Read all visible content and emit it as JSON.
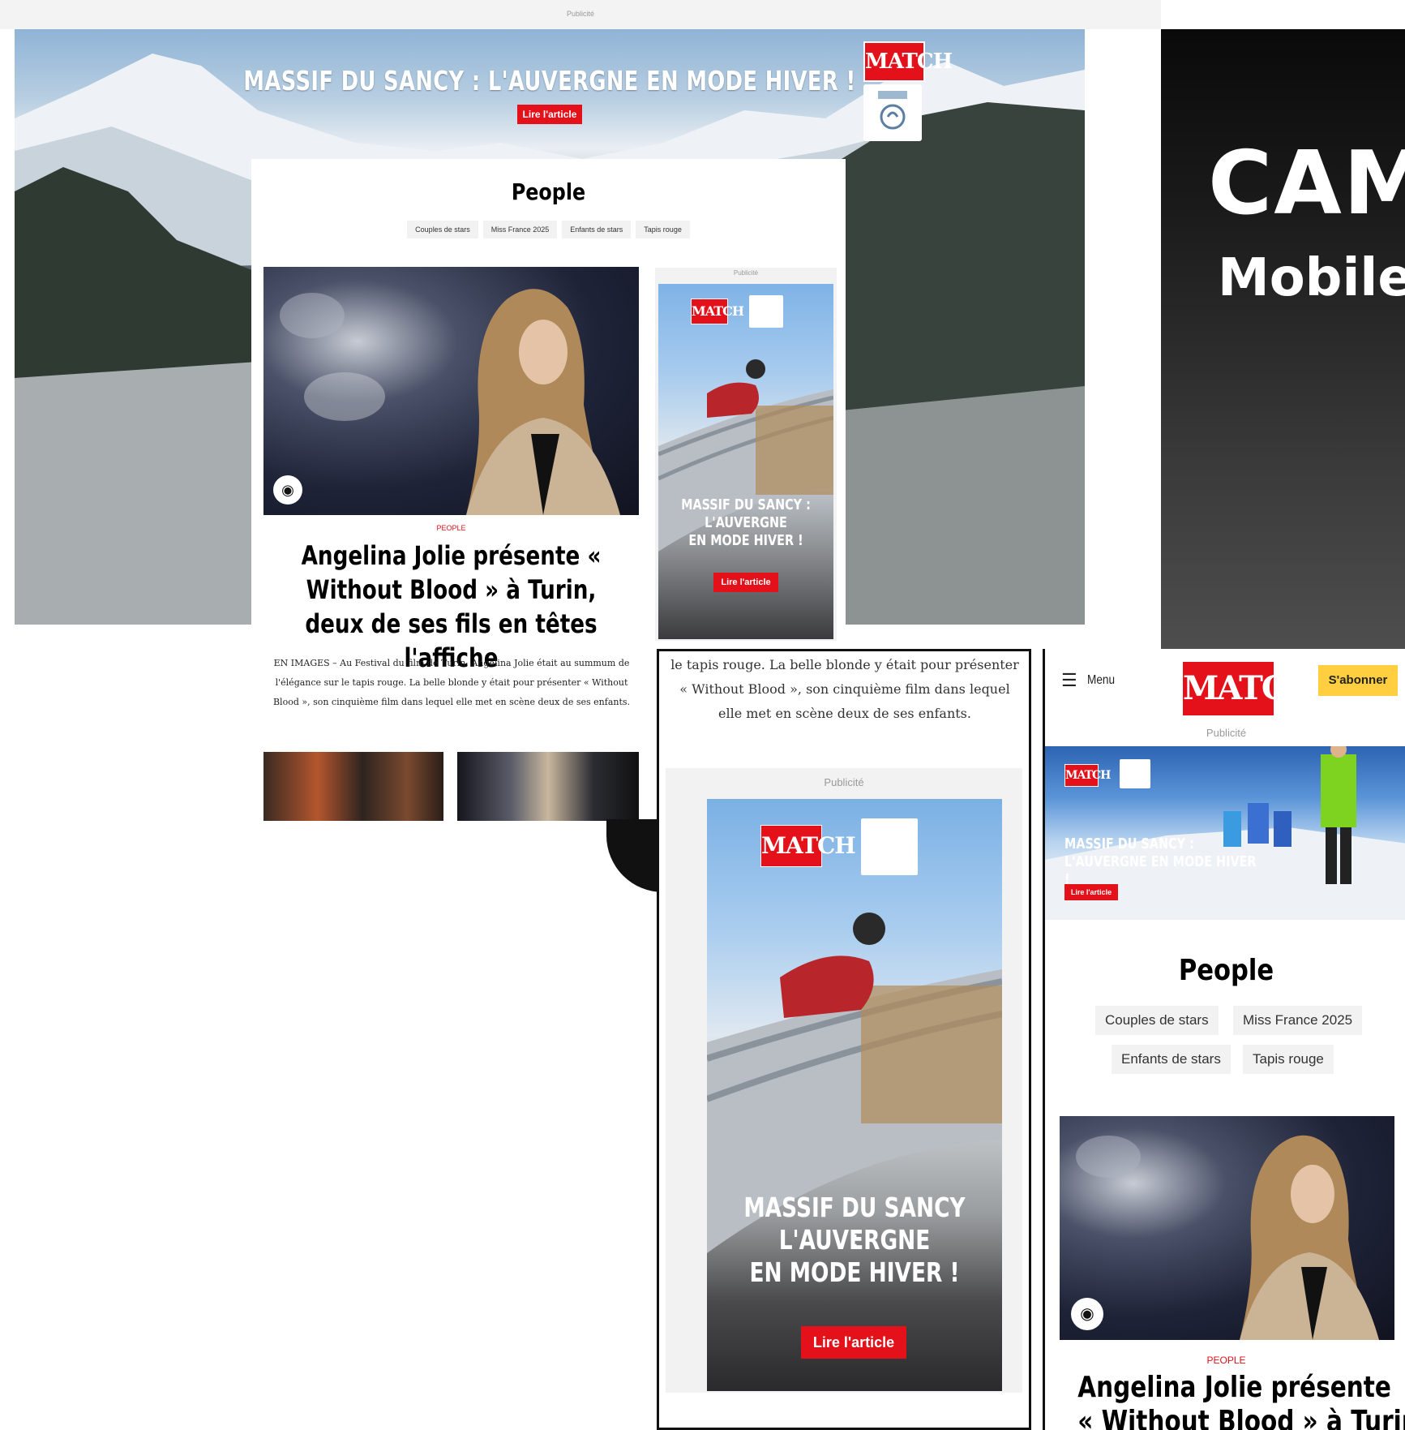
{
  "desktop": {
    "topbar_pub": "Publicité",
    "skin": {
      "title": "MASSIF DU SANCY : L'AUVERGNE EN MODE HIVER !",
      "cta": "Lire l'article",
      "logo": "MATCH"
    },
    "section_title": "People",
    "tags": [
      "Couples de stars",
      "Miss France 2025",
      "Enfants de stars",
      "Tapis rouge"
    ],
    "camera_icon": "camera-icon",
    "kicker": "PEOPLE",
    "headline": "Angelina Jolie présente « Without Blood » à Turin, deux de ses fils en têtes l'affiche",
    "chapo": "EN IMAGES – Au Festival du film de Turin, Angelina Jolie était au summum de l'élégance sur le tapis rouge. La belle blonde y était pour présenter « Without Blood », son cinquième film dans lequel elle met en scène deux de ses enfants.",
    "side_ad": {
      "pub": "Publicité",
      "logo": "MATCH",
      "line1": "MASSIF DU SANCY :",
      "line2": "L'AUVERGNE",
      "line3": "EN MODE HIVER !",
      "cta": "Lire l'article"
    }
  },
  "dark_panel": {
    "title": "CAM",
    "subtitle": "Mobile"
  },
  "tablet": {
    "text": "le tapis rouge. La belle blonde y était pour présenter « Without Blood », son cinquième film dans lequel elle met en scène deux de ses enfants.",
    "pub": "Publicité",
    "ad": {
      "logo": "MATCH",
      "line1": "MASSIF DU SANCY :",
      "line2": "L'AUVERGNE",
      "line3": "EN MODE HIVER !",
      "cta": "Lire l'article"
    }
  },
  "mobile": {
    "menu_icon": "hamburger-icon",
    "menu": "Menu",
    "logo": "MATCH",
    "subscribe": "S'abonner",
    "pub": "Publicité",
    "ad": {
      "logo": "MATCH",
      "line1": "MASSIF DU SANCY :",
      "line2": "L'AUVERGNE EN MODE HIVER !",
      "cta": "Lire l'article"
    },
    "section_title": "People",
    "tags": [
      "Couples de stars",
      "Miss France 2025",
      "Enfants de stars",
      "Tapis rouge"
    ],
    "camera_icon": "camera-icon",
    "kicker": "PEOPLE",
    "headline_line1": "Angelina Jolie présente",
    "headline_line2": "« Without Blood » à Turin, deux"
  }
}
